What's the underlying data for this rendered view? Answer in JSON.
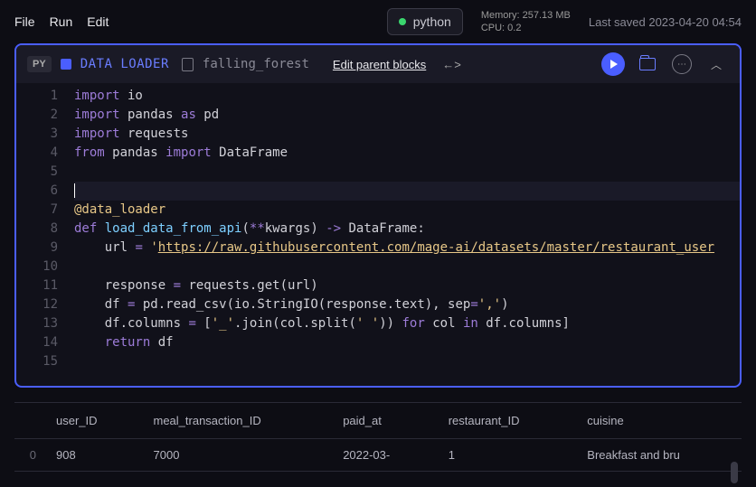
{
  "topbar": {
    "menu": [
      "File",
      "Run",
      "Edit"
    ],
    "kernel": {
      "label": "python"
    },
    "memory_label": "Memory: 257.13 MB",
    "cpu_label": "CPU: 0.2",
    "last_saved": "Last saved 2023-04-20 04:54"
  },
  "block": {
    "lang_badge": "PY",
    "type": "DATA LOADER",
    "name": "falling_forest",
    "edit_parent": "Edit parent blocks"
  },
  "code": {
    "lines": [
      {
        "n": "1",
        "t": [
          {
            "c": "kw",
            "v": "import"
          },
          {
            "v": " io"
          }
        ]
      },
      {
        "n": "2",
        "t": [
          {
            "c": "kw",
            "v": "import"
          },
          {
            "v": " pandas "
          },
          {
            "c": "kw",
            "v": "as"
          },
          {
            "v": " pd"
          }
        ]
      },
      {
        "n": "3",
        "t": [
          {
            "c": "kw",
            "v": "import"
          },
          {
            "v": " requests"
          }
        ]
      },
      {
        "n": "4",
        "t": [
          {
            "c": "kw",
            "v": "from"
          },
          {
            "v": " pandas "
          },
          {
            "c": "kw",
            "v": "import"
          },
          {
            "v": " DataFrame"
          }
        ]
      },
      {
        "n": "5",
        "t": []
      },
      {
        "n": "6",
        "t": [],
        "active": true,
        "cursor": true
      },
      {
        "n": "7",
        "t": [
          {
            "c": "deco",
            "v": "@data_loader"
          }
        ]
      },
      {
        "n": "8",
        "t": [
          {
            "c": "kw",
            "v": "def"
          },
          {
            "v": " "
          },
          {
            "c": "fn",
            "v": "load_data_from_api"
          },
          {
            "v": "("
          },
          {
            "c": "op",
            "v": "**"
          },
          {
            "v": "kwargs) "
          },
          {
            "c": "op",
            "v": "->"
          },
          {
            "v": " DataFrame:"
          }
        ]
      },
      {
        "n": "9",
        "t": [
          {
            "v": "    url "
          },
          {
            "c": "op",
            "v": "="
          },
          {
            "v": " "
          },
          {
            "c": "str",
            "v": "'"
          },
          {
            "c": "url",
            "v": "https://raw.githubusercontent.com/mage-ai/datasets/master/restaurant_user"
          }
        ]
      },
      {
        "n": "10",
        "t": []
      },
      {
        "n": "11",
        "t": [
          {
            "v": "    response "
          },
          {
            "c": "op",
            "v": "="
          },
          {
            "v": " requests.get(url)"
          }
        ]
      },
      {
        "n": "12",
        "t": [
          {
            "v": "    df "
          },
          {
            "c": "op",
            "v": "="
          },
          {
            "v": " pd.read_csv(io.StringIO(response.text), sep"
          },
          {
            "c": "op",
            "v": "="
          },
          {
            "c": "str",
            "v": "','"
          },
          {
            "v": ")"
          }
        ]
      },
      {
        "n": "13",
        "t": [
          {
            "v": "    df.columns "
          },
          {
            "c": "op",
            "v": "="
          },
          {
            "v": " ["
          },
          {
            "c": "str",
            "v": "'_'"
          },
          {
            "v": ".join(col.split("
          },
          {
            "c": "str",
            "v": "' '"
          },
          {
            "v": ")) "
          },
          {
            "c": "kw",
            "v": "for"
          },
          {
            "v": " col "
          },
          {
            "c": "kw",
            "v": "in"
          },
          {
            "v": " df.columns]"
          }
        ]
      },
      {
        "n": "14",
        "t": [
          {
            "v": "    "
          },
          {
            "c": "kw",
            "v": "return"
          },
          {
            "v": " df"
          }
        ]
      },
      {
        "n": "15",
        "t": []
      }
    ]
  },
  "output": {
    "columns": [
      "user_ID",
      "meal_transaction_ID",
      "paid_at",
      "restaurant_ID",
      "cuisine"
    ],
    "rows": [
      {
        "idx": "0",
        "cells": [
          "908",
          "7000",
          "2022-03-",
          "1",
          "Breakfast and bru"
        ]
      }
    ]
  }
}
